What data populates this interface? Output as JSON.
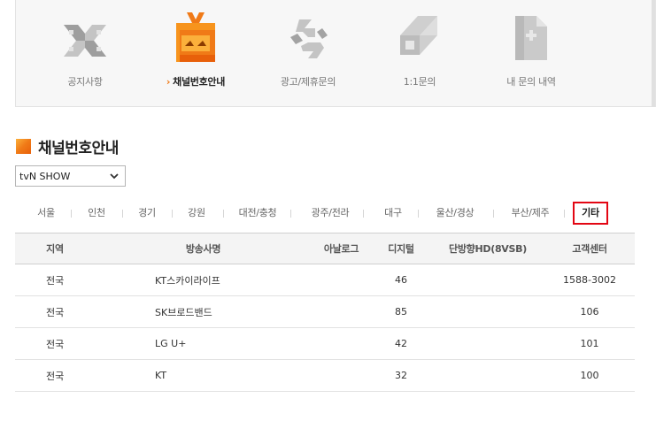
{
  "nav": {
    "items": [
      {
        "label": "공지사항",
        "icon": "notice-icon",
        "active": false
      },
      {
        "label": "채널번호안내",
        "icon": "tv-icon",
        "active": true
      },
      {
        "label": "광고/제휴문의",
        "icon": "ad-icon",
        "active": false
      },
      {
        "label": "1:1문의",
        "icon": "inquiry-icon",
        "active": false
      },
      {
        "label": "내 문의 내역",
        "icon": "history-icon",
        "active": false
      }
    ],
    "active_marker": "›"
  },
  "section": {
    "title": "채널번호안내"
  },
  "channel_select": {
    "value": "tvN SHOW"
  },
  "region_tabs": [
    {
      "label": "서울"
    },
    {
      "label": "인천"
    },
    {
      "label": "경기"
    },
    {
      "label": "강원"
    },
    {
      "label": "대전/충청"
    },
    {
      "label": "광주/전라"
    },
    {
      "label": "대구"
    },
    {
      "label": "울산/경상"
    },
    {
      "label": "부산/제주"
    },
    {
      "label": "기타",
      "selected": true
    }
  ],
  "table": {
    "headers": [
      "지역",
      "방송사명",
      "아날로그",
      "디지털",
      "단방향HD(8VSB)",
      "고객센터"
    ],
    "rows": [
      [
        "전국",
        "KT스카이라이프",
        "",
        "46",
        "",
        "1588-3002"
      ],
      [
        "전국",
        "SK브로드밴드",
        "",
        "85",
        "",
        "106"
      ],
      [
        "전국",
        "LG U+",
        "",
        "42",
        "",
        "101"
      ],
      [
        "전국",
        "KT",
        "",
        "32",
        "",
        "100"
      ]
    ]
  },
  "colors": {
    "accent": "#f07a17",
    "selected_border": "#e30613",
    "icon_gray": "#bdbdbd"
  }
}
